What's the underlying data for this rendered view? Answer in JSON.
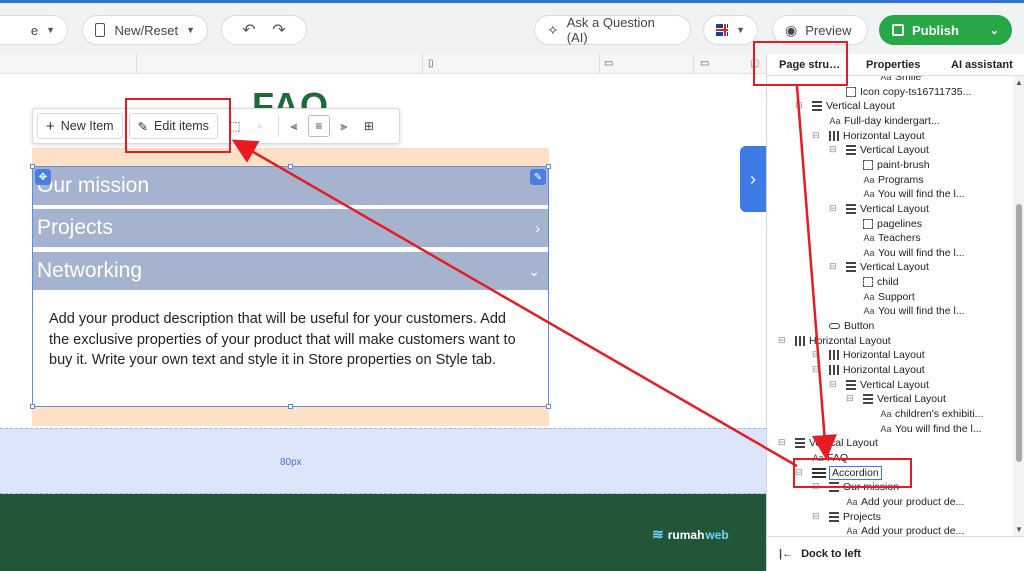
{
  "topbar": {
    "page_select_label": "e",
    "new_reset_label": "New/Reset",
    "ask_label": "Ask a Question (AI)",
    "preview_label": "Preview",
    "publish_label": "Publish"
  },
  "canvas": {
    "faq_title": "FAQ",
    "toolbar": {
      "new_item_label": "New Item",
      "edit_items_label": "Edit items"
    },
    "accordion": {
      "items": [
        "Our mission",
        "Projects",
        "Networking"
      ],
      "body": "Add your product description that will be useful for your customers. Add the exclusive properties of your product that will make customers want to buy it. Write your own text and style it in Store properties on Style tab."
    },
    "spacer_label": "80px",
    "logo": {
      "part1": "rumah",
      "part2": "web"
    }
  },
  "panel": {
    "tabs": [
      "Page stru…",
      "Properties",
      "AI assistant"
    ],
    "tree": [
      {
        "label": "Smile",
        "icon": "text"
      },
      {
        "label": "Icon copy-ts16711735...",
        "icon": "image"
      },
      {
        "label": "Vertical Layout",
        "icon": "vertical"
      },
      {
        "label": "Full-day kindergart...",
        "icon": "text"
      },
      {
        "label": "Horizontal Layout",
        "icon": "horizontal"
      },
      {
        "label": "Vertical Layout",
        "icon": "vertical"
      },
      {
        "label": "paint-brush",
        "icon": "image"
      },
      {
        "label": "Programs",
        "icon": "text"
      },
      {
        "label": "You will find the l...",
        "icon": "text"
      },
      {
        "label": "Vertical Layout",
        "icon": "vertical"
      },
      {
        "label": "pagelines",
        "icon": "image"
      },
      {
        "label": "Teachers",
        "icon": "text"
      },
      {
        "label": "You will find the l...",
        "icon": "text"
      },
      {
        "label": "Vertical Layout",
        "icon": "vertical"
      },
      {
        "label": "child",
        "icon": "image"
      },
      {
        "label": "Support",
        "icon": "text"
      },
      {
        "label": "You will find the l...",
        "icon": "text"
      },
      {
        "label": "Button",
        "icon": "button"
      },
      {
        "label": "Horizontal Layout",
        "icon": "horizontal"
      },
      {
        "label": "Horizontal Layout",
        "icon": "horizontal"
      },
      {
        "label": "Horizontal Layout",
        "icon": "horizontal"
      },
      {
        "label": "Vertical Layout",
        "icon": "vertical"
      },
      {
        "label": "Vertical Layout",
        "icon": "vertical"
      },
      {
        "label": "children's exhibiti...",
        "icon": "text"
      },
      {
        "label": "You will find the l...",
        "icon": "text"
      },
      {
        "label": "Vertical Layout",
        "icon": "vertical"
      },
      {
        "label": "FAQ",
        "icon": "text"
      },
      {
        "label": "Accordion",
        "icon": "accordion"
      },
      {
        "label": "Our mission",
        "icon": "vertical"
      },
      {
        "label": "Add your product de...",
        "icon": "text"
      },
      {
        "label": "Projects",
        "icon": "vertical"
      },
      {
        "label": "Add your product de...",
        "icon": "text"
      }
    ],
    "dock_label": "Dock to left"
  },
  "colors": {
    "publish_green": "#27a745",
    "accordion_header": "#a5b3cf",
    "footer_green": "#235638",
    "annotation_red": "#e81b23",
    "selection_blue": "#3d7ce6"
  }
}
